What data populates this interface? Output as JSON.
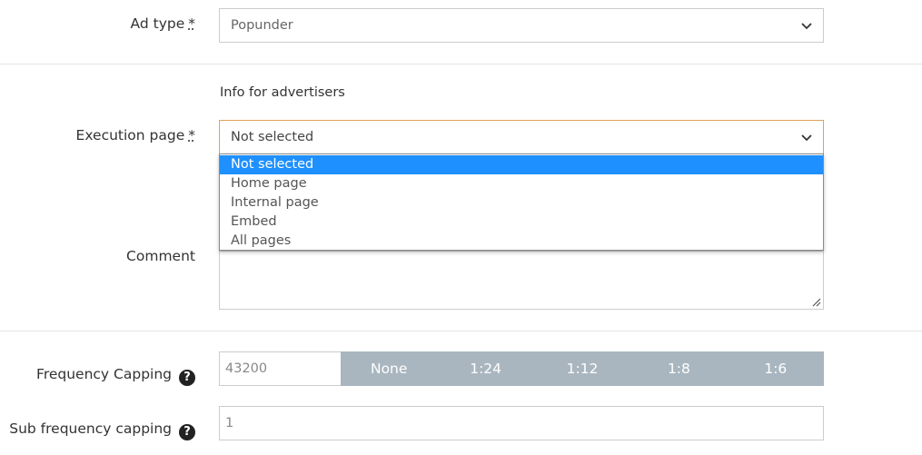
{
  "ad_type": {
    "label": "Ad type",
    "required_mark": "*",
    "value": "Popunder",
    "icon": "chevron-down-icon"
  },
  "info_heading": "Info for advertisers",
  "execution_page": {
    "label": "Execution page",
    "required_mark": "*",
    "value": "Not selected",
    "icon": "chevron-down-icon",
    "options": [
      {
        "label": "Not selected",
        "selected": true
      },
      {
        "label": "Home page",
        "selected": false
      },
      {
        "label": "Internal page",
        "selected": false
      },
      {
        "label": "Embed",
        "selected": false
      },
      {
        "label": "All pages",
        "selected": false
      }
    ]
  },
  "comment": {
    "label": "Comment",
    "value": ""
  },
  "frequency_capping": {
    "label": "Frequency Capping",
    "help_icon": "?",
    "value": "43200",
    "presets": [
      "None",
      "1:24",
      "1:12",
      "1:8",
      "1:6"
    ]
  },
  "sub_frequency_capping": {
    "label": "Sub frequency capping",
    "help_icon": "?",
    "value": "1"
  },
  "colors": {
    "accent": "#1e90ff",
    "focus_border": "#e0a15c",
    "preset_bg": "#a9b6bf"
  }
}
